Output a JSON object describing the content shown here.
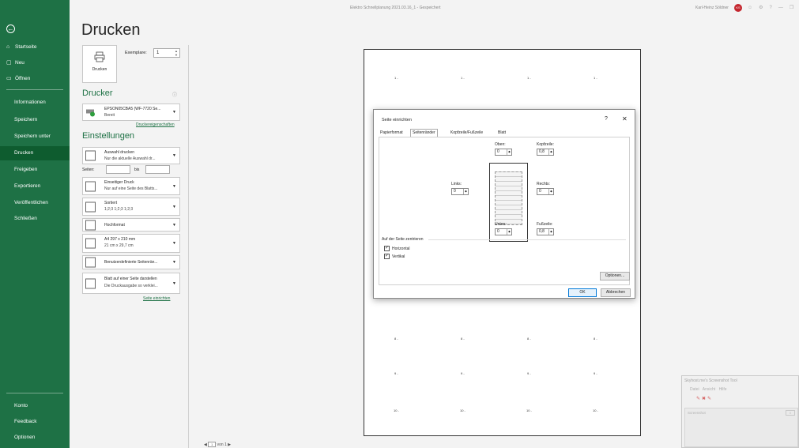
{
  "window": {
    "title": "Elektro Schnellplanung 2021.03.16_1 - Gespeichert",
    "user": "Karl-Heinz Söldner",
    "avatar_initials": "KS",
    "controls": [
      "☺",
      "⚙",
      "?",
      "—",
      "❐",
      "✕"
    ]
  },
  "sidebar": {
    "back_icon": "arrow-left-icon",
    "items": [
      {
        "label": "Startseite",
        "icon": "home-icon",
        "glyph": "⌂"
      },
      {
        "label": "Neu",
        "icon": "new-document-icon",
        "glyph": "▢"
      },
      {
        "label": "Öffnen",
        "icon": "folder-open-icon",
        "glyph": "▭"
      },
      {
        "label": "Informationen"
      },
      {
        "label": "Speichern"
      },
      {
        "label": "Speichern unter"
      },
      {
        "label": "Drucken"
      },
      {
        "label": "Freigeben"
      },
      {
        "label": "Exportieren"
      },
      {
        "label": "Veröffentlichen"
      },
      {
        "label": "Schließen"
      }
    ],
    "bottom": [
      {
        "label": "Konto"
      },
      {
        "label": "Feedback"
      },
      {
        "label": "Optionen"
      }
    ],
    "active_color": "#0e5c2f",
    "brand_color": "#1e7145"
  },
  "print": {
    "title": "Drucken",
    "button_label": "Drucken",
    "copies_label": "Exemplare:",
    "copies_value": "1",
    "printer_heading": "Drucker",
    "printer_name": "EPSON05CBA5 (WF-7720 Se...",
    "printer_status": "Bereit",
    "printer_props_link": "Druckereigenschaften",
    "settings_heading": "Einstellungen",
    "settings": {
      "scope_1": "Auswahl drucken",
      "scope_2": "Nur die aktuelle Auswahl dr...",
      "pages_label": "Seiten:",
      "pages_to": "bis",
      "sides_1": "Einseitiger Druck",
      "sides_2": "Nur auf eine Seite des Blatts...",
      "collate_1": "Sortiert",
      "collate_2": "1;2;3   1;2;3   1;2;3",
      "orientation": "Hochformat",
      "paper_1": "A4 297 x 210 mm",
      "paper_2": "21 cm x 29,7 cm",
      "margins": "Benutzerdefinierte Seitenrän...",
      "scaling_1": "Blatt auf einer Seite darstellen",
      "scaling_2": "Die Druckausgabe so verklei...",
      "page_setup_link": "Seite einrichten"
    }
  },
  "preview": {
    "row_labels": [
      "1 -",
      "8 -",
      "9 -",
      "10 -"
    ],
    "pager_current": "1",
    "pager_total": "von 1"
  },
  "dialog": {
    "title": "Seite einrichten",
    "help": "?",
    "close": "✕",
    "tabs": [
      "Papierformat",
      "Seitenränder",
      "Kopfzeile/Fußzeile",
      "Blatt"
    ],
    "fields": {
      "top_label": "Oben:",
      "top_value": "0",
      "header_label": "Kopfzeile:",
      "header_value": "0,8",
      "left_label": "Links:",
      "left_value": "0",
      "right_label": "Rechts:",
      "right_value": "0",
      "bottom_label": "Unten:",
      "bottom_value": "0",
      "footer_label": "Fußzeile:",
      "footer_value": "0,8"
    },
    "center_heading": "Auf der Seite zentrieren",
    "horizontal": "Horizontal",
    "vertical": "Vertikal",
    "options_button": "Optionen...",
    "ok_button": "OK",
    "cancel_button": "Abbrechen"
  },
  "mini_window": {
    "title": "Skyhost.me's Screenshot Tool",
    "menu": "Datei  Ansicht  Hilfe",
    "inner_title": "Screenshot",
    "inner_button": "X"
  }
}
